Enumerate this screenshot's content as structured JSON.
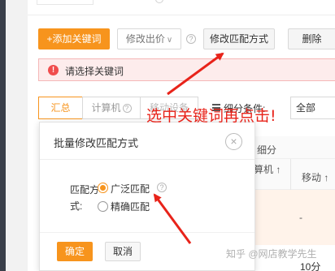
{
  "toolbar": {
    "add_keyword": "+添加关键词",
    "edit_bid": "修改出价",
    "edit_match": "修改匹配方式",
    "delete": "删除"
  },
  "alert": {
    "message": "请选择关键词"
  },
  "tabs": {
    "all": "汇总",
    "pc": "计算机",
    "mobile": "移动设备"
  },
  "filter": {
    "label": "细分条件:",
    "value": "全部"
  },
  "table": {
    "group_header": "细分",
    "col_pc": "计算机 ↑",
    "col_mobile": "移动 ↑",
    "dash": "-",
    "bottom_value": "10分"
  },
  "modal": {
    "title": "批量修改匹配方式",
    "close_symbol": "×",
    "match_label": "匹配方式:",
    "option_broad": "广泛匹配",
    "option_exact": "精确匹配",
    "ok": "确定",
    "cancel": "取消"
  },
  "annotation": {
    "text": "选中关键词再点击!"
  },
  "watermark": "知乎 @网店教学先生",
  "colors": {
    "accent_orange": "#f7941d",
    "annotation_red": "#e8231a",
    "alert_bg": "#fdecec"
  }
}
